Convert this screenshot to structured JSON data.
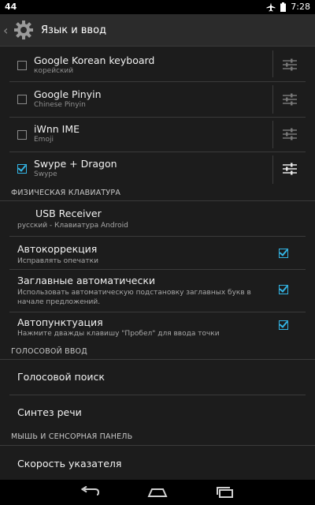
{
  "status_bar": {
    "left_text": "44",
    "time": "7:28"
  },
  "action_bar": {
    "title": "Язык и ввод"
  },
  "input_methods": [
    {
      "name": "Google Korean keyboard",
      "subtitle": "корейский",
      "checked": false
    },
    {
      "name": "Google Pinyin",
      "subtitle": "Chinese Pinyin",
      "checked": false
    },
    {
      "name": "iWnn IME",
      "subtitle": "Emoji",
      "checked": false
    },
    {
      "name": "Swype + Dragon",
      "subtitle": "Swype",
      "checked": true
    }
  ],
  "physical_keyboard": {
    "header": "ФИЗИЧЕСКАЯ КЛАВИАТУРА",
    "device": "USB Receiver",
    "layout": "русский - Клавиатура Android"
  },
  "prefs": [
    {
      "title": "Автокоррекция",
      "subtitle": "Исправлять опечатки",
      "checked": true
    },
    {
      "title": "Заглавные автоматически",
      "subtitle": "Использовать автоматическую подстановку заглавных букв в начале предложений.",
      "checked": true
    },
    {
      "title": "Автопунктуация",
      "subtitle": "Нажмите дважды клавишу \"Пробел\" для ввода точки",
      "checked": true
    }
  ],
  "voice_input": {
    "header": "ГОЛОСОВОЙ ВВОД",
    "search": "Голосовой поиск",
    "tts": "Синтез речи"
  },
  "mouse": {
    "header": "МЫШЬ И СЕНСОРНАЯ ПАНЕЛЬ",
    "pointer_speed": "Скорость указателя"
  },
  "colors": {
    "accent": "#33b5e5",
    "background": "#1c1c1c"
  },
  "icons": [
    "airplane-icon",
    "battery-icon",
    "gear-icon",
    "settings-sliders-icon",
    "nav-back-icon",
    "nav-home-icon",
    "nav-recents-icon"
  ]
}
